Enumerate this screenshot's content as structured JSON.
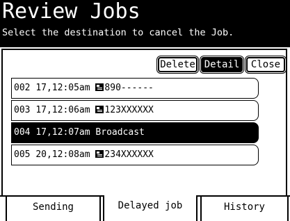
{
  "header": {
    "title": "Review Jobs",
    "subtitle": "Select the destination to cancel the Job."
  },
  "toolbar": {
    "delete_label": "Delete",
    "detail_label": "Detail",
    "close_label": "Close"
  },
  "jobs": [
    {
      "id": "002",
      "time": "17,12:05am",
      "icon": "fax-icon",
      "destination": "890------",
      "selected": false
    },
    {
      "id": "003",
      "time": "17,12:06am",
      "icon": "fax-icon",
      "destination": "123XXXXXX",
      "selected": false
    },
    {
      "id": "004",
      "time": "17,12:07am",
      "icon": "",
      "destination": "Broadcast",
      "selected": true
    },
    {
      "id": "005",
      "time": "20,12:08am",
      "icon": "fax-icon",
      "destination": "234XXXXXX",
      "selected": false
    }
  ],
  "tabs": {
    "sending": "Sending",
    "delayed": "Delayed job",
    "history": "History",
    "active": "delayed"
  },
  "colors": {
    "background": "#ffffff",
    "foreground": "#000000"
  }
}
